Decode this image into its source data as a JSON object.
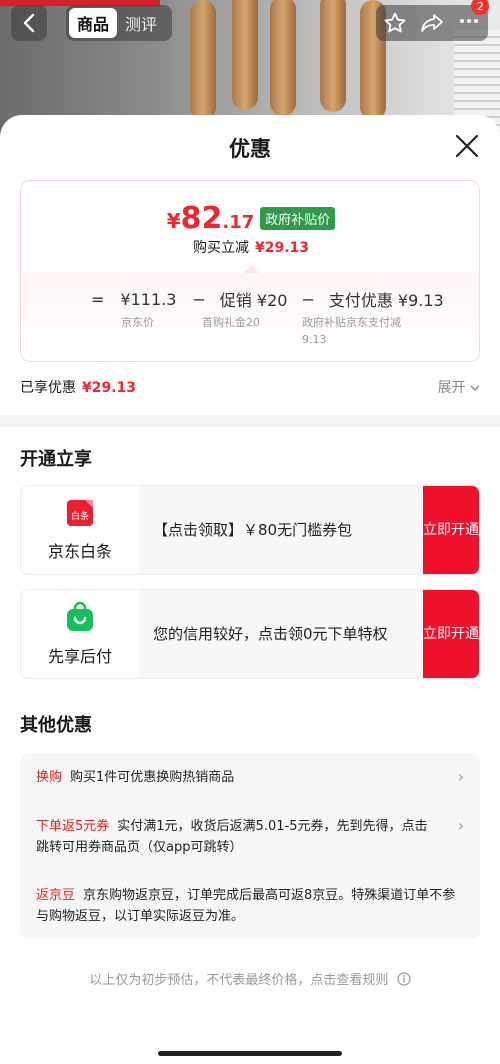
{
  "nav": {
    "tabs": [
      "商品",
      "测评"
    ],
    "badge_count": "2"
  },
  "sheet": {
    "title": "优惠"
  },
  "price_card": {
    "currency": "¥",
    "price_int": "82",
    "price_dec": ".17",
    "gov_tag": "政府补贴价",
    "reduce_label": "购买立减",
    "reduce_amount": "¥29.13",
    "eq": "=",
    "base_price": "¥111.3",
    "minus1": "−",
    "promo": "促销 ¥20",
    "minus2": "−",
    "pay_discount": "支付优惠 ¥9.13",
    "base_label": "京东价",
    "promo_label": "首购礼金20",
    "pay_label": "政府补贴京东支付减9.13"
  },
  "summary": {
    "enjoyed_label": "已享优惠",
    "enjoyed_amount": "¥29.13",
    "expand_label": "展开"
  },
  "open_section": {
    "title": "开通立享",
    "cards": [
      {
        "name": "京东白条",
        "icon_text": "白条",
        "desc": "【点击领取】￥80无门槛券包",
        "button": "立即开通"
      },
      {
        "name": "先享后付",
        "desc": "您的信用较好，点击领0元下单特权",
        "button": "立即开通"
      }
    ]
  },
  "other_section": {
    "title": "其他优惠",
    "items": [
      {
        "tag": "换购",
        "text": "购买1件可优惠换购热销商品"
      },
      {
        "tag": "下单返5元券",
        "text": "实付满1元，收货后返满5.01-5元券，先到先得，点击跳转可用券商品页（仅app可跳转）"
      },
      {
        "tag": "返京豆",
        "text": "京东购物返京豆，订单完成后最高可返8京豆。特殊渠道订单不参与购物返豆，以订单实际返豆为准。"
      }
    ]
  },
  "footnote": "以上仅为初步预估，不代表最终价格，点击查看规则",
  "colors": {
    "accent_red": "#f0252f",
    "gov_green": "#2f9a4a",
    "button_red": "#f0102b"
  }
}
